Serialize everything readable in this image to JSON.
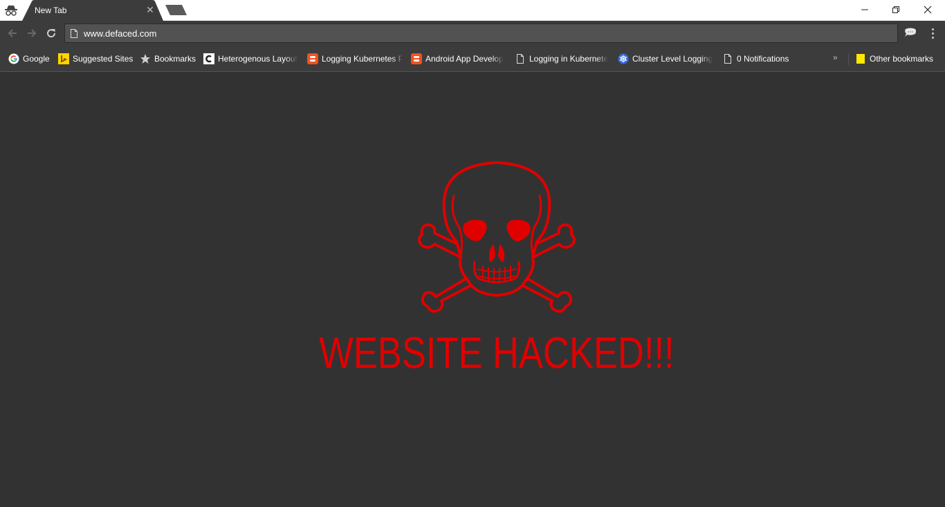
{
  "browser": {
    "tab": {
      "title": "New Tab"
    },
    "address_bar": {
      "url": "www.defaced.com"
    },
    "window_controls": [
      "minimize-icon",
      "restore-icon",
      "close-icon"
    ],
    "bookmarks": [
      {
        "label": "Google",
        "icon": "google-icon"
      },
      {
        "label": "Suggested Sites",
        "icon": "bing-icon"
      },
      {
        "label": "Bookmarks",
        "icon": "star-icon"
      },
      {
        "label": "Heterogenous Layout",
        "icon": "c-logo-icon"
      },
      {
        "label": "Logging Kubernetes P",
        "icon": "blogger-icon"
      },
      {
        "label": "Android App Develop",
        "icon": "blogger-icon"
      },
      {
        "label": "Logging in Kubernete",
        "icon": "page-icon"
      },
      {
        "label": "Cluster Level Logging",
        "icon": "kubernetes-icon"
      },
      {
        "label": "0 Notifications",
        "icon": "page-icon"
      }
    ],
    "overflow": "»",
    "other_bookmarks": {
      "label": "Other bookmarks",
      "icon": "folder-icon"
    }
  },
  "page": {
    "headline": "WEBSITE HACKED!!!",
    "image": "skull-and-crossbones-icon",
    "colors": {
      "accent": "#e00000",
      "background": "#323232"
    }
  }
}
